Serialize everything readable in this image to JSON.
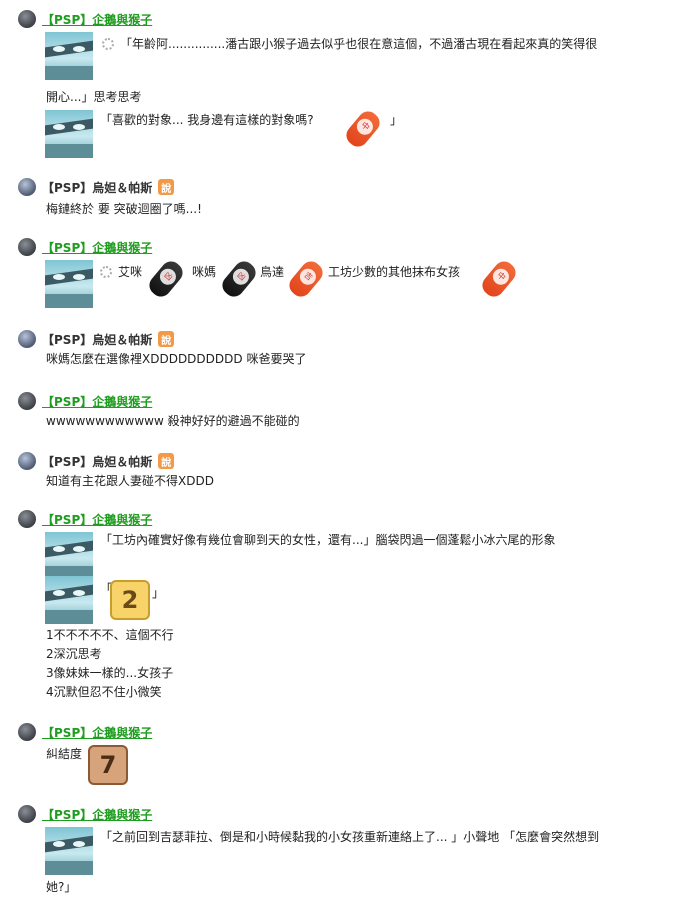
{
  "posts": [
    {
      "name": "【PSP】企鵝與猴子",
      "lines": [
        "「年齡阿...............潘古跟小猴子過去似乎也很在意這個，不過潘古現在看起來真的笑得很",
        "開心...」思考思考",
        "「喜歡的對象... 我身邊有這樣的對象嗎?",
        "」"
      ]
    },
    {
      "name": "【PSP】烏妲＆帕斯",
      "say": "說",
      "lines": [
        "梅鏈終於 要 突破迴圈了嗎...!"
      ]
    },
    {
      "name": "【PSP】企鵝與猴子",
      "segments": [
        "艾咪",
        "咪媽",
        "鳥達",
        "工坊少數的其他抹布女孩"
      ]
    },
    {
      "name": "【PSP】烏妲＆帕斯",
      "say": "說",
      "lines": [
        "咪媽怎麼在選像裡XDDDDDDDDDD 咪爸要哭了"
      ]
    },
    {
      "name": "【PSP】企鵝與猴子",
      "lines": [
        "wwwwwwwwwwww 殺神好好的避過不能碰的"
      ]
    },
    {
      "name": "【PSP】烏妲＆帕斯",
      "say": "說",
      "lines": [
        "知道有主花跟人妻碰不得XDDD"
      ]
    },
    {
      "name": "【PSP】企鵝與猴子",
      "lines": [
        "「工坊內確實好像有幾位會聊到天的女性，還有...」腦袋閃過一個蓬鬆小冰六尾的形象",
        "「",
        "」",
        "1不不不不不、這個不行",
        "2深沉思考",
        "3像妹妹一樣的...女孩子",
        "4沉默但忍不住小微笑"
      ],
      "number": "2"
    },
    {
      "name": "【PSP】企鵝與猴子",
      "lines": [
        "糾結度"
      ],
      "number": "7"
    },
    {
      "name": "【PSP】企鵝與猴子",
      "lines": [
        "「之前回到吉瑟菲拉、倒是和小時候黏我的小女孩重新連絡上了... 」小聲地 「怎麼會突然想到",
        "她?」"
      ]
    }
  ],
  "pill_tags": {
    "orange": "吉",
    "dark": "凶",
    "mid": "中"
  },
  "colors": {
    "green_name": "#1f9d1f",
    "say_badge": "#f29a4a"
  }
}
